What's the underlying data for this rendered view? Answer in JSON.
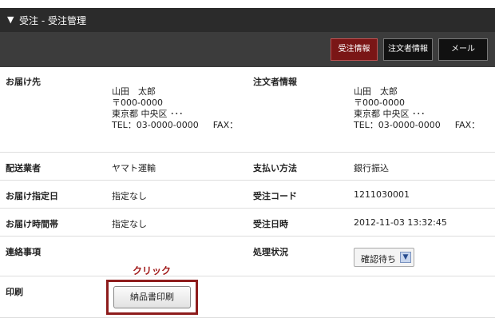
{
  "header": {
    "title": "受注 - 受注管理",
    "collapse_icon": "triangle-down-icon"
  },
  "toolbar": {
    "tabs": [
      "受注情報",
      "注文者情報",
      "メール"
    ],
    "active": 0
  },
  "shipping_address": {
    "label": "お届け先",
    "name": "山田　太郎",
    "postal": "〒000-0000",
    "address": "東京都 中央区 ･･･",
    "tel": "TEL：03-0000-0000",
    "fax": "FAX："
  },
  "orderer": {
    "label": "注文者情報",
    "name": "山田　太郎",
    "postal": "〒000-0000",
    "address": "東京都 中央区 ･･･",
    "tel": "TEL：03-0000-0000",
    "fax": "FAX："
  },
  "fields": {
    "carrier_label": "配送業者",
    "carrier": "ヤマト運輸",
    "payment_label": "支払い方法",
    "payment": "銀行振込",
    "delivery_date_label": "お届け指定日",
    "delivery_date": "指定なし",
    "order_code_label": "受注コード",
    "order_code": "1211030001",
    "delivery_time_label": "お届け時間帯",
    "delivery_time": "指定なし",
    "order_datetime_label": "受注日時",
    "order_datetime": "2012-11-03 13:32:45",
    "notes_label": "連絡事項",
    "status_label": "処理状況",
    "status_value": "確認待ち",
    "print_label": "印刷",
    "print_button": "納品書印刷"
  },
  "annotation": {
    "text": "クリック",
    "color": "#a11a1a"
  },
  "colors": {
    "active_tab": "#7a1616",
    "header_bg": "#2b2b2b",
    "toolbar_bg": "#3c3c3c"
  }
}
